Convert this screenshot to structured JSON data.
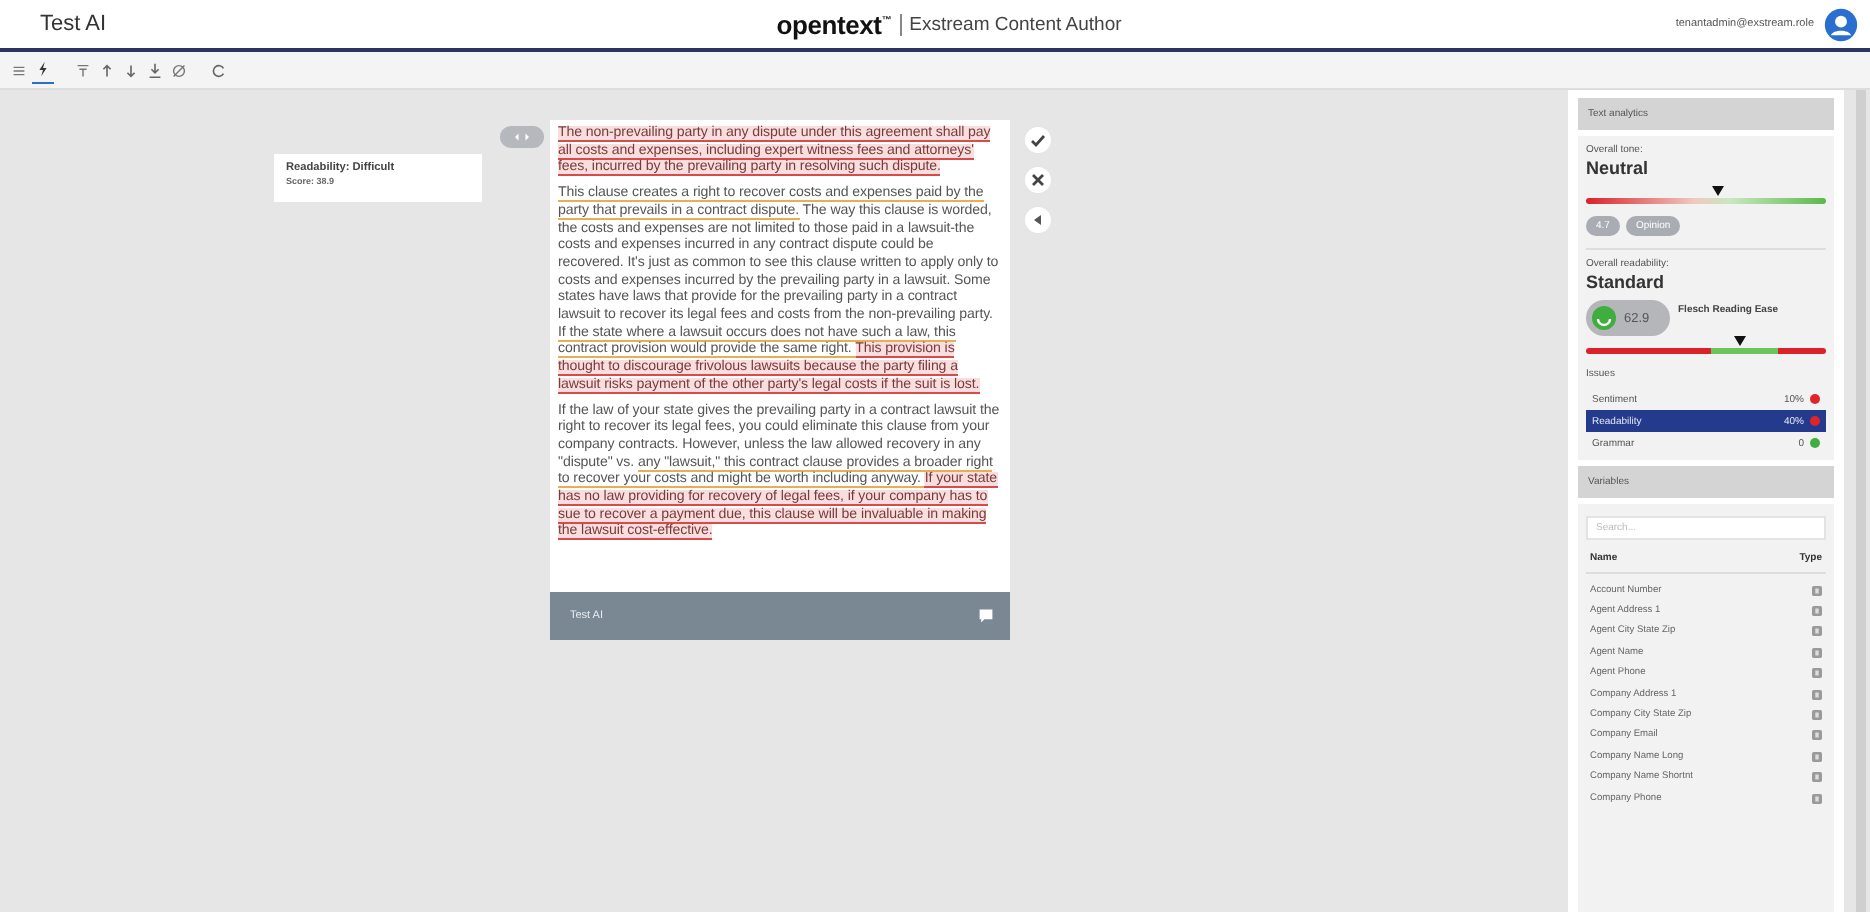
{
  "header": {
    "app_name": "Test AI",
    "logo": "opentext",
    "logo_mark": "™",
    "product": "Exstream Content Author",
    "user": "tenantadmin@exstream.role"
  },
  "toolbar": [
    {
      "kind": "list",
      "selected": false
    },
    {
      "kind": "bolt",
      "selected": true
    },
    {
      "kind": "filter",
      "selected": false
    },
    {
      "kind": "up",
      "selected": false
    },
    {
      "kind": "down",
      "selected": false
    },
    {
      "kind": "download",
      "selected": false
    },
    {
      "kind": "hide",
      "selected": false
    },
    {
      "kind": "refresh",
      "selected": false
    }
  ],
  "readability_card": {
    "title": "Readability: Difficult",
    "score": "Score: 38.9"
  },
  "document": {
    "paragraphs": [
      [
        {
          "kind": "error",
          "text": "The non-prevailing party in any dispute under this agreement shall pay all costs and expenses, including expert witness fees and attorneys' fees, incurred by the prevailing party in resolving such dispute."
        }
      ],
      [
        {
          "kind": "warning",
          "text": "This clause creates a right to recover costs and expenses paid by the party that prevails in a contract dispute."
        },
        {
          "kind": "plain",
          "text": " The way this clause is worded, the costs and expenses are not limited to those paid in a lawsuit-the costs and expenses incurred in any contract dispute could be recovered. It's just as common to see this clause written to apply only to costs and expenses incurred by the prevailing party in a lawsuit. Some states have laws that provide for the prevailing party in a contract lawsuit to recover its legal fees and costs from the non-prevailing party. "
        },
        {
          "kind": "warning",
          "text": "If the state where a lawsuit occurs does not have such a law, this contract provision would provide the same right. "
        },
        {
          "kind": "error",
          "text": "This provision is thought to discourage frivolous lawsuits because the party filing a lawsuit risks payment of the other party's legal costs if the suit is lost."
        }
      ],
      [
        {
          "kind": "plain",
          "text": "If the law of your state gives the prevailing party in a contract lawsuit the right to recover its legal fees, you could eliminate this clause from your company contracts. However, unless the law allowed recovery in any \"dispute\" vs. "
        },
        {
          "kind": "warning",
          "text": "any \"lawsuit,\" this contract clause provides a broader right to recover your costs and might be worth including anyway. "
        },
        {
          "kind": "error",
          "text": "If your state has no law providing for recovery of legal fees, if your company has to sue to recover a payment due, this clause will be invaluable in making the lawsuit cost-effective."
        }
      ]
    ],
    "footer": "Test AI"
  },
  "analytics": {
    "title": "Text analytics",
    "tone_label": "Overall tone:",
    "tone": "Neutral",
    "tone_meter": {
      "level": 0.55
    },
    "chips": [
      "4.7",
      "Opinion"
    ],
    "readability_label": "Overall readability:",
    "readability": "Standard",
    "score": "62.9",
    "score_name": "Flesch Reading Ease",
    "readability_meter": {
      "level": 0.64
    },
    "issues_label": "Issues",
    "issues": [
      {
        "name": "Sentiment",
        "value": "10%",
        "color": "#e0242c",
        "selected": false
      },
      {
        "name": "Readability",
        "value": "40%",
        "color": "#e0242c",
        "selected": true
      },
      {
        "name": "Grammar",
        "value": "0",
        "color": "#3fae3f",
        "selected": false
      }
    ]
  },
  "variables": {
    "title": "Variables",
    "search": {
      "placeholder": "Search..."
    },
    "columns": [
      "Name",
      "Type"
    ],
    "rows": [
      "Account Number",
      "Agent Address 1",
      "Agent City State Zip",
      "Agent Name",
      "Agent Phone",
      "Company Address 1",
      "Company City State Zip",
      "Company Email",
      "Company Name Long",
      "Company Name Shortnt",
      "Company Phone"
    ]
  }
}
